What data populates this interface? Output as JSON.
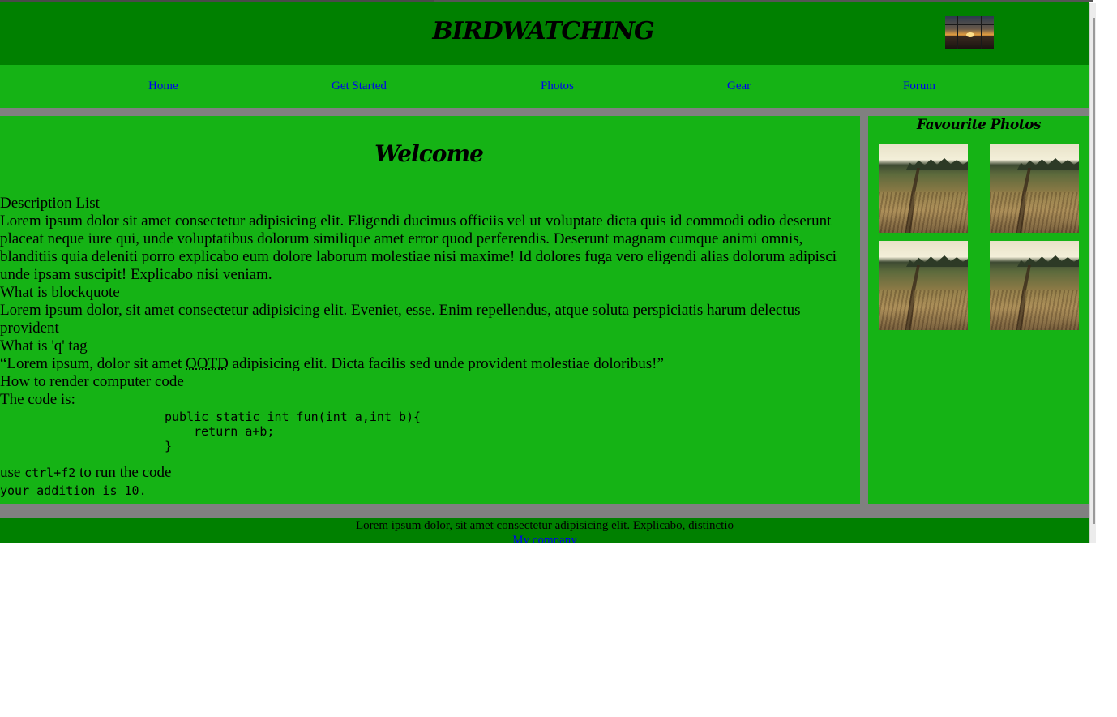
{
  "header": {
    "title": "BIRDWATCHING",
    "thumb_icon": "sunset-window-image"
  },
  "nav": {
    "items": [
      {
        "label": "Home"
      },
      {
        "label": "Get Started"
      },
      {
        "label": "Photos"
      },
      {
        "label": "Gear"
      },
      {
        "label": "Forum"
      }
    ]
  },
  "main": {
    "heading": "Welcome",
    "dl_term_1": "Description List",
    "dl_desc_1": "Lorem ipsum dolor sit amet consectetur adipisicing elit. Eligendi ducimus officiis vel ut voluptate dicta quis id commodi odio deserunt placeat neque iure qui, unde voluptatibus dolorum similique amet error quod perferendis. Deserunt magnam cumque animi omnis, blanditiis quia deleniti porro explicabo eum dolore laborum molestiae nisi maxime! Id dolores fuga vero eligendi alias dolorum adipisci unde ipsam suscipit! Explicabo nisi veniam.",
    "dl_term_2": "What is blockquote",
    "dl_desc_2": "Lorem ipsum dolor, sit amet consectetur adipisicing elit. Eveniet, esse. Enim repellendus, atque soluta perspiciatis harum delectus provident",
    "dl_term_3": "What is 'q' tag",
    "q_open": "“Lorem ipsum, dolor sit amet ",
    "q_abbr": "OOTD",
    "q_close": " adipisicing elit. Dicta facilis sed unde provident molestiae doloribus!”",
    "dl_term_4": "How to render computer code",
    "code_intro": "The code is:",
    "code_block": "public static int fun(int a,int b){\n    return a+b;\n}",
    "run_prefix": "use ",
    "run_kbd": "ctrl+f2",
    "run_suffix": " to run the code",
    "output": "your addition is 10."
  },
  "aside": {
    "title": "Favourite Photos",
    "photos": [
      "field-path-photo",
      "field-path-photo",
      "field-path-photo",
      "field-path-photo"
    ]
  },
  "footer": {
    "text": "Lorem ipsum dolor, sit amet consectetur adipisicing elit. Explicabo, distinctio",
    "link": "My company"
  },
  "colors": {
    "header_bg": "#008000",
    "nav_bg": "#15b315",
    "page_bg": "#808080",
    "link": "#0000ee"
  }
}
